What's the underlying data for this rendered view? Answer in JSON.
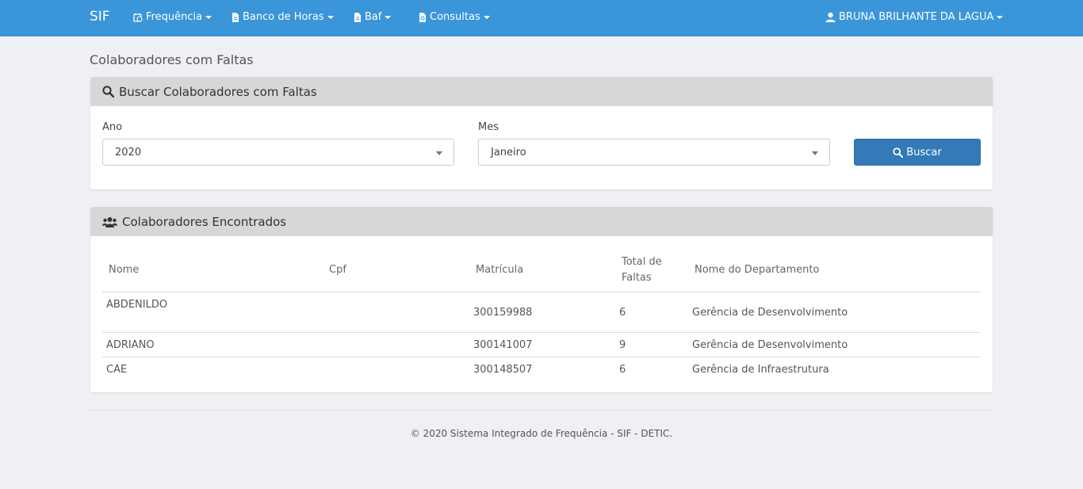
{
  "navbar": {
    "brand": "SIF",
    "items": [
      {
        "label": "Frequência",
        "icon": "calendar-clock-icon"
      },
      {
        "label": "Banco de Horas",
        "icon": "document-icon"
      },
      {
        "label": "Baf",
        "icon": "document-icon"
      },
      {
        "label": "Consultas",
        "icon": "document-search-icon"
      }
    ],
    "user": {
      "label": "BRUNA BRILHANTE DA LAGUA",
      "icon": "user-icon"
    }
  },
  "page_title": "Colaboradores com Faltas",
  "search_panel": {
    "title": "Buscar Colaboradores com Faltas",
    "ano_label": "Ano",
    "ano_value": "2020",
    "mes_label": "Mes",
    "mes_value": "Janeiro",
    "button_label": "Buscar"
  },
  "results_panel": {
    "title": "Colaboradores Encontrados",
    "headers": {
      "nome": "Nome",
      "cpf": "Cpf",
      "matricula": "Matrícula",
      "total_faltas_1": "Total de",
      "total_faltas_2": "Faltas",
      "departamento": "Nome do Departamento"
    },
    "rows": [
      {
        "nome": "ABDENILDO",
        "cpf": "",
        "matricula": "300159988",
        "faltas": "6",
        "departamento": "Gerência de Desenvolvimento"
      },
      {
        "nome": "ADRIANO",
        "cpf": "",
        "matricula": "300141007",
        "faltas": "9",
        "departamento": "Gerência de Desenvolvimento"
      },
      {
        "nome": "CAE",
        "cpf": "",
        "matricula": "300148507",
        "faltas": "6",
        "departamento": "Gerência de Infraestrutura"
      }
    ]
  },
  "footer": "© 2020 Sistema Integrado de Frequência - SIF - DETIC.",
  "colors": {
    "navbar": "#3a95d9",
    "primary_button": "#337ab7",
    "panel_heading": "#d7d7d7"
  }
}
